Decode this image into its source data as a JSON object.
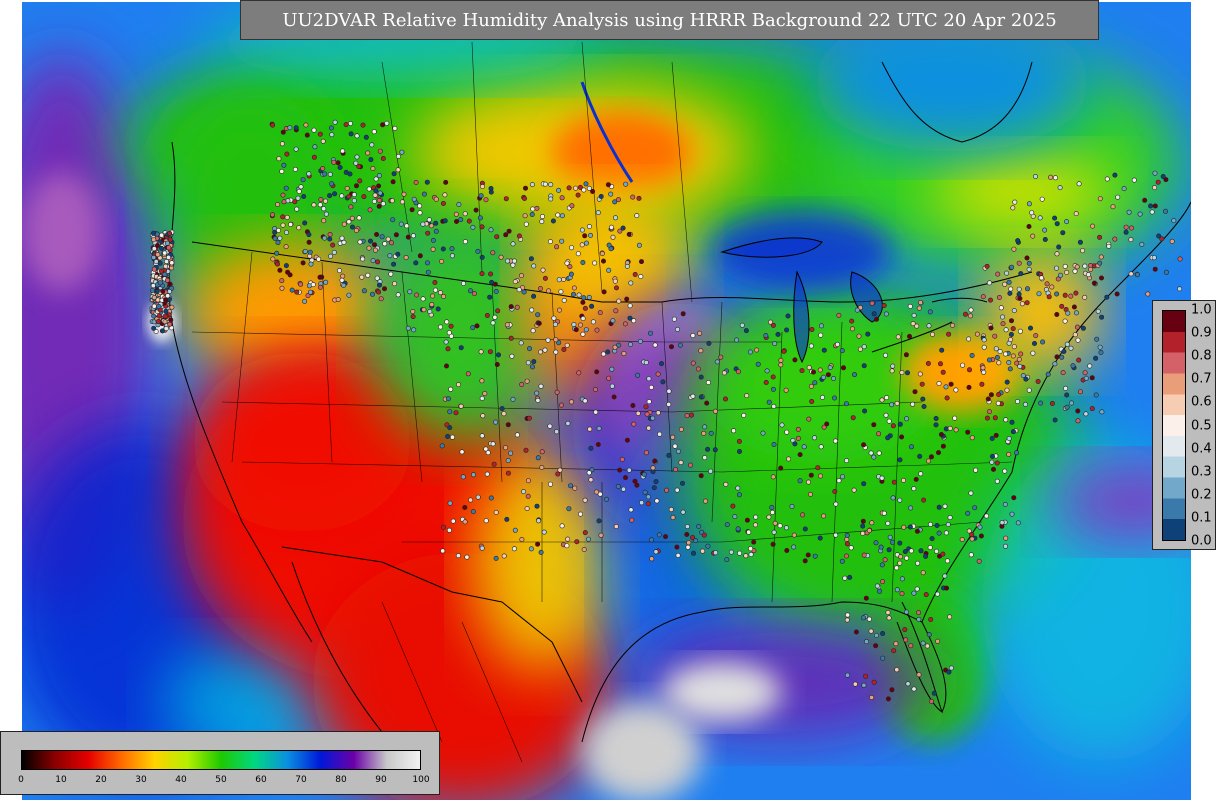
{
  "title": "UU2DVAR Relative Humidity Analysis using HRRR Background 22 UTC 20 Apr 2025",
  "main_legend": {
    "ticks": [
      "0",
      "10",
      "20",
      "30",
      "40",
      "50",
      "60",
      "70",
      "80",
      "90",
      "100"
    ],
    "colors": [
      "#000000",
      "#8b0000",
      "#e60000",
      "#ff6a00",
      "#ffd200",
      "#b4f000",
      "#1ec800",
      "#00d880",
      "#0a90e0",
      "#0018d8",
      "#6a00a8",
      "#c8c8c8",
      "#f2f2f2"
    ]
  },
  "obs_legend": {
    "ticks": [
      "1.0",
      "0.9",
      "0.8",
      "0.7",
      "0.6",
      "0.5",
      "0.4",
      "0.3",
      "0.2",
      "0.1",
      "0.0"
    ],
    "colors": [
      "#670010",
      "#b3212b",
      "#d36167",
      "#e99d78",
      "#f6cdb3",
      "#fbf0ea",
      "#e3eaee",
      "#b7d4e2",
      "#72a8c9",
      "#3a7aab",
      "#0e4178"
    ]
  },
  "map": {
    "ocean_color": "#1f7ff0",
    "dry_color": "#ee1000",
    "moist_color": "#1ec800",
    "saturated_color": "#d8d8d8",
    "boundary_color": "#000000",
    "marker_outline": "#222222"
  }
}
